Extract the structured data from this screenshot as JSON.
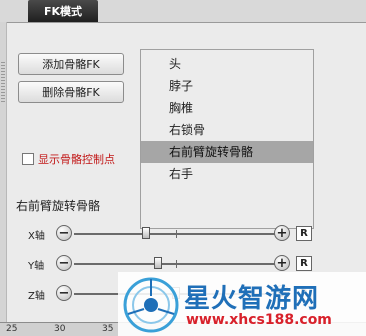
{
  "tab": {
    "label": "FK模式"
  },
  "buttons": {
    "add": "添加骨骼FK",
    "remove": "删除骨骼FK"
  },
  "checkbox": {
    "label": "显示骨骼控制点",
    "checked": false
  },
  "selected_label": "右前臂旋转骨骼",
  "bone_list": [
    {
      "label": "头",
      "selected": false
    },
    {
      "label": "脖子",
      "selected": false
    },
    {
      "label": "胸椎",
      "selected": false
    },
    {
      "label": "右锁骨",
      "selected": false
    },
    {
      "label": "右前臂旋转骨骼",
      "selected": true
    },
    {
      "label": "右手",
      "selected": false
    }
  ],
  "sliders": [
    {
      "axis": "X轴",
      "value": -0.29,
      "reset": "R"
    },
    {
      "axis": "Y轴",
      "value": -0.18,
      "reset": "R"
    },
    {
      "axis": "Z轴",
      "value": 0.0,
      "reset": "R"
    }
  ],
  "ruler": {
    "numbers": [
      "25",
      "30",
      "35"
    ]
  },
  "watermark": {
    "title": "星火智游网",
    "url": "www.xhcs188.com"
  }
}
